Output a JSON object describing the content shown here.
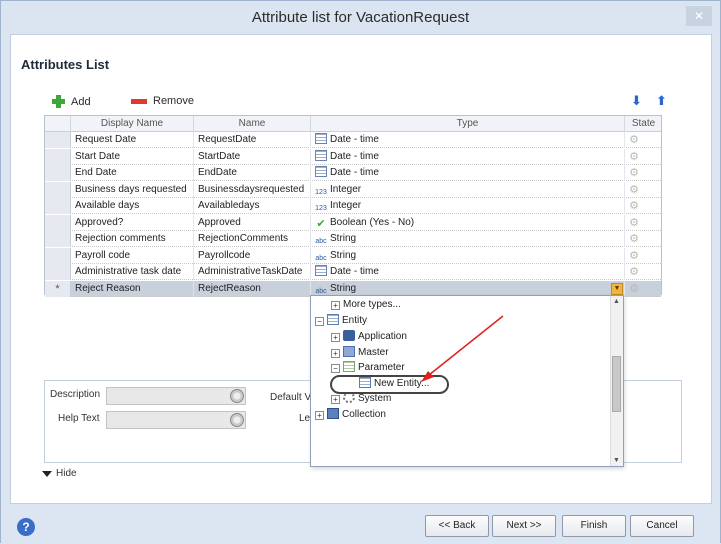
{
  "window": {
    "title": "Attribute list for VacationRequest",
    "close_label": "✕"
  },
  "section_title": "Attributes List",
  "toolbar": {
    "add_label": "Add",
    "remove_label": "Remove"
  },
  "grid": {
    "headers": [
      "Display Name",
      "Name",
      "Type",
      "State"
    ],
    "rows": [
      {
        "display": "Request Date",
        "name": "RequestDate",
        "type": "Date - time",
        "icon": "calendar-icon"
      },
      {
        "display": "Start Date",
        "name": "StartDate",
        "type": "Date - time",
        "icon": "calendar-icon"
      },
      {
        "display": "End Date",
        "name": "EndDate",
        "type": "Date - time",
        "icon": "calendar-icon"
      },
      {
        "display": "Business days requested",
        "name": "Businessdaysrequested",
        "type": "Integer",
        "icon": "integer-icon"
      },
      {
        "display": "Available days",
        "name": "Availabledays",
        "type": "Integer",
        "icon": "integer-icon"
      },
      {
        "display": "Approved?",
        "name": "Approved",
        "type": "Boolean (Yes - No)",
        "icon": "checkmark-icon"
      },
      {
        "display": "Rejection comments",
        "name": "RejectionComments",
        "type": "String",
        "icon": "string-icon"
      },
      {
        "display": "Payroll code",
        "name": "Payrollcode",
        "type": "String",
        "icon": "string-icon"
      },
      {
        "display": "Administrative task date",
        "name": "AdministrativeTaskDate",
        "type": "Date - time",
        "icon": "calendar-icon"
      },
      {
        "display": "Reject Reason",
        "name": "RejectReason",
        "type": "String",
        "icon": "string-icon"
      }
    ],
    "new_row_marker": "*",
    "type_glyphs": {
      "integer": "123",
      "string": "abc",
      "bool": "✔"
    }
  },
  "type_tree": {
    "more_types": "More types...",
    "entity": "Entity",
    "application": "Application",
    "master": "Master",
    "parameter": "Parameter",
    "new_entity": "New Entity...",
    "system": "System",
    "collection": "Collection"
  },
  "form": {
    "description_label": "Description",
    "help_text_label": "Help Text",
    "default_label": "Default V",
    "le_label": "Le"
  },
  "hide_label": "Hide",
  "buttons": {
    "back": "<< Back",
    "next": "Next >>",
    "finish": "Finish",
    "cancel": "Cancel"
  },
  "help_glyph": "?",
  "colors": {
    "accent_arrow": "#e0201b",
    "selected_row": "#c8d0dc",
    "add_green": "#3fa63c",
    "remove_red": "#e03a2f"
  }
}
